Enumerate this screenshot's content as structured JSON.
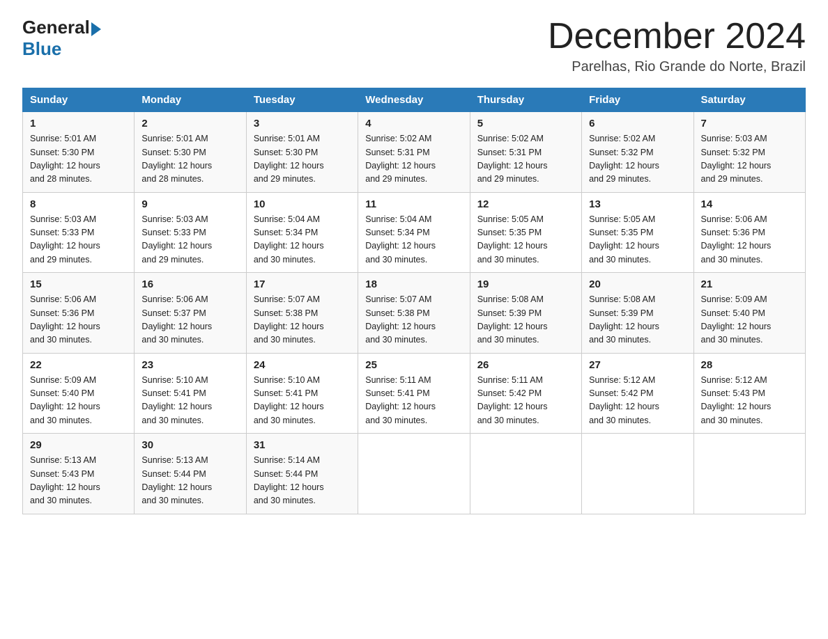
{
  "header": {
    "logo_general": "General",
    "logo_blue": "Blue",
    "title": "December 2024",
    "subtitle": "Parelhas, Rio Grande do Norte, Brazil"
  },
  "columns": [
    "Sunday",
    "Monday",
    "Tuesday",
    "Wednesday",
    "Thursday",
    "Friday",
    "Saturday"
  ],
  "weeks": [
    [
      {
        "day": "1",
        "sunrise": "5:01 AM",
        "sunset": "5:30 PM",
        "daylight": "12 hours and 28 minutes."
      },
      {
        "day": "2",
        "sunrise": "5:01 AM",
        "sunset": "5:30 PM",
        "daylight": "12 hours and 28 minutes."
      },
      {
        "day": "3",
        "sunrise": "5:01 AM",
        "sunset": "5:30 PM",
        "daylight": "12 hours and 29 minutes."
      },
      {
        "day": "4",
        "sunrise": "5:02 AM",
        "sunset": "5:31 PM",
        "daylight": "12 hours and 29 minutes."
      },
      {
        "day": "5",
        "sunrise": "5:02 AM",
        "sunset": "5:31 PM",
        "daylight": "12 hours and 29 minutes."
      },
      {
        "day": "6",
        "sunrise": "5:02 AM",
        "sunset": "5:32 PM",
        "daylight": "12 hours and 29 minutes."
      },
      {
        "day": "7",
        "sunrise": "5:03 AM",
        "sunset": "5:32 PM",
        "daylight": "12 hours and 29 minutes."
      }
    ],
    [
      {
        "day": "8",
        "sunrise": "5:03 AM",
        "sunset": "5:33 PM",
        "daylight": "12 hours and 29 minutes."
      },
      {
        "day": "9",
        "sunrise": "5:03 AM",
        "sunset": "5:33 PM",
        "daylight": "12 hours and 29 minutes."
      },
      {
        "day": "10",
        "sunrise": "5:04 AM",
        "sunset": "5:34 PM",
        "daylight": "12 hours and 30 minutes."
      },
      {
        "day": "11",
        "sunrise": "5:04 AM",
        "sunset": "5:34 PM",
        "daylight": "12 hours and 30 minutes."
      },
      {
        "day": "12",
        "sunrise": "5:05 AM",
        "sunset": "5:35 PM",
        "daylight": "12 hours and 30 minutes."
      },
      {
        "day": "13",
        "sunrise": "5:05 AM",
        "sunset": "5:35 PM",
        "daylight": "12 hours and 30 minutes."
      },
      {
        "day": "14",
        "sunrise": "5:06 AM",
        "sunset": "5:36 PM",
        "daylight": "12 hours and 30 minutes."
      }
    ],
    [
      {
        "day": "15",
        "sunrise": "5:06 AM",
        "sunset": "5:36 PM",
        "daylight": "12 hours and 30 minutes."
      },
      {
        "day": "16",
        "sunrise": "5:06 AM",
        "sunset": "5:37 PM",
        "daylight": "12 hours and 30 minutes."
      },
      {
        "day": "17",
        "sunrise": "5:07 AM",
        "sunset": "5:38 PM",
        "daylight": "12 hours and 30 minutes."
      },
      {
        "day": "18",
        "sunrise": "5:07 AM",
        "sunset": "5:38 PM",
        "daylight": "12 hours and 30 minutes."
      },
      {
        "day": "19",
        "sunrise": "5:08 AM",
        "sunset": "5:39 PM",
        "daylight": "12 hours and 30 minutes."
      },
      {
        "day": "20",
        "sunrise": "5:08 AM",
        "sunset": "5:39 PM",
        "daylight": "12 hours and 30 minutes."
      },
      {
        "day": "21",
        "sunrise": "5:09 AM",
        "sunset": "5:40 PM",
        "daylight": "12 hours and 30 minutes."
      }
    ],
    [
      {
        "day": "22",
        "sunrise": "5:09 AM",
        "sunset": "5:40 PM",
        "daylight": "12 hours and 30 minutes."
      },
      {
        "day": "23",
        "sunrise": "5:10 AM",
        "sunset": "5:41 PM",
        "daylight": "12 hours and 30 minutes."
      },
      {
        "day": "24",
        "sunrise": "5:10 AM",
        "sunset": "5:41 PM",
        "daylight": "12 hours and 30 minutes."
      },
      {
        "day": "25",
        "sunrise": "5:11 AM",
        "sunset": "5:41 PM",
        "daylight": "12 hours and 30 minutes."
      },
      {
        "day": "26",
        "sunrise": "5:11 AM",
        "sunset": "5:42 PM",
        "daylight": "12 hours and 30 minutes."
      },
      {
        "day": "27",
        "sunrise": "5:12 AM",
        "sunset": "5:42 PM",
        "daylight": "12 hours and 30 minutes."
      },
      {
        "day": "28",
        "sunrise": "5:12 AM",
        "sunset": "5:43 PM",
        "daylight": "12 hours and 30 minutes."
      }
    ],
    [
      {
        "day": "29",
        "sunrise": "5:13 AM",
        "sunset": "5:43 PM",
        "daylight": "12 hours and 30 minutes."
      },
      {
        "day": "30",
        "sunrise": "5:13 AM",
        "sunset": "5:44 PM",
        "daylight": "12 hours and 30 minutes."
      },
      {
        "day": "31",
        "sunrise": "5:14 AM",
        "sunset": "5:44 PM",
        "daylight": "12 hours and 30 minutes."
      },
      null,
      null,
      null,
      null
    ]
  ],
  "labels": {
    "sunrise": "Sunrise:",
    "sunset": "Sunset:",
    "daylight": "Daylight:"
  }
}
